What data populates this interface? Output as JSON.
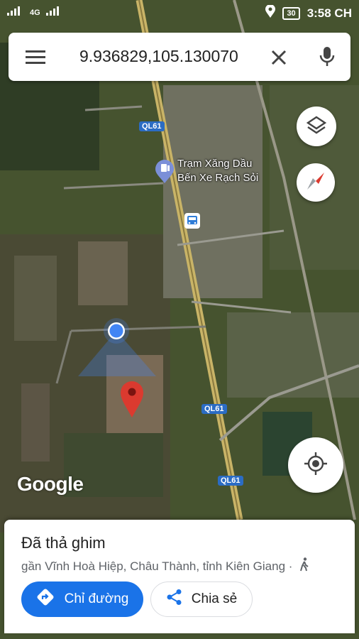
{
  "status_bar": {
    "network": "4G",
    "battery": "30",
    "time": "3:58 CH"
  },
  "search": {
    "query": "9.936829,105.130070"
  },
  "map": {
    "road_labels": [
      "QL61",
      "QL61",
      "QL61"
    ],
    "place_name_line1": "Trạm Xăng Dầu",
    "place_name_line2": "Bến Xe Rạch Sỏi",
    "logo_text": "Google"
  },
  "sheet": {
    "title": "Đã thả ghim",
    "subtitle": "gần Vĩnh Hoà Hiệp, Châu Thành, tỉnh Kiên Giang ·",
    "directions_label": "Chỉ đường",
    "share_label": "Chia sẻ"
  },
  "icons": [
    "menu-icon",
    "close-icon",
    "mic-icon",
    "layers-icon",
    "compass-icon",
    "gas-station-icon",
    "bus-stop-icon",
    "my-location-icon",
    "walk-icon",
    "directions-icon",
    "share-icon",
    "pin-icon"
  ],
  "colors": {
    "accent": "#1a73e8",
    "pin": "#db3a2f",
    "location_dot": "#4285f4"
  }
}
